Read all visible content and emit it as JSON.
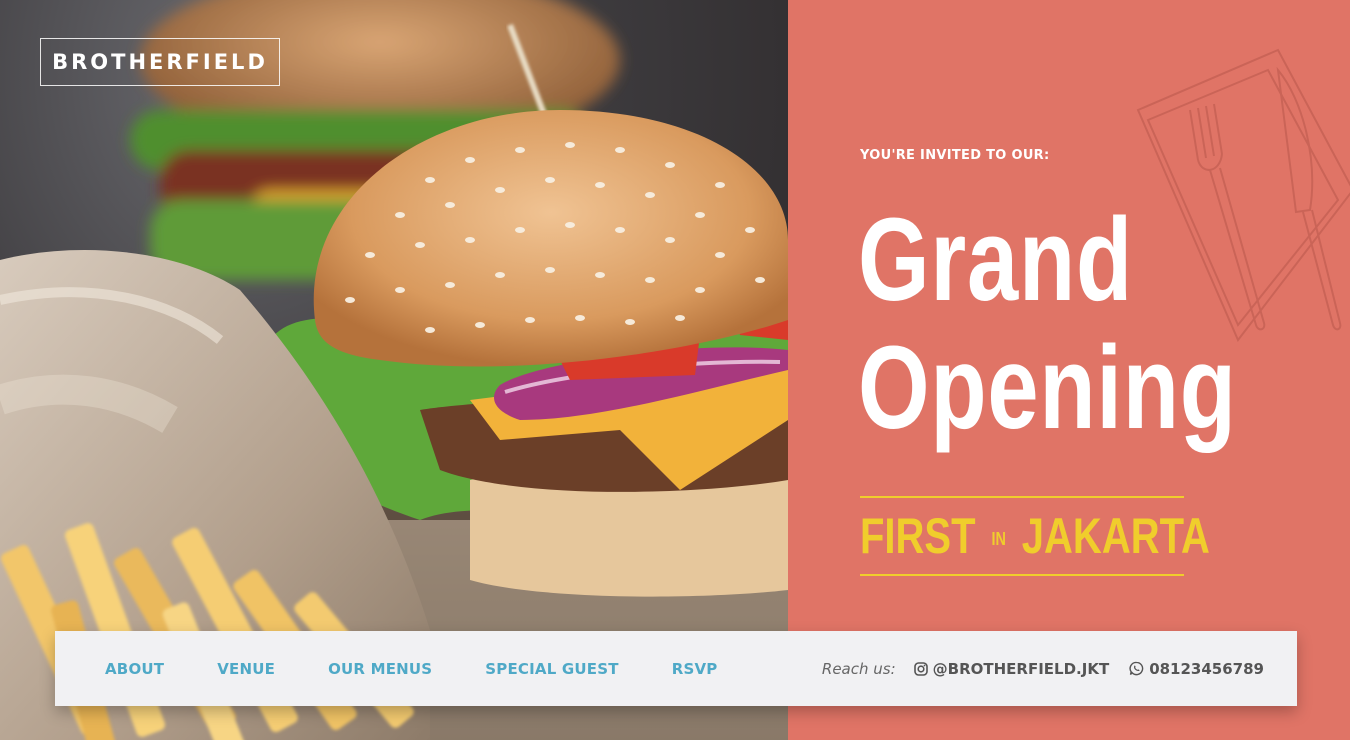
{
  "brand": {
    "name": "BROTHERFIELD"
  },
  "hero": {
    "invite": "YOU'RE INVITED TO OUR:",
    "title_line1": "Grand",
    "title_line2": "Opening",
    "sub_first": "FIRST",
    "sub_in": "IN",
    "sub_city": "JAKARTA"
  },
  "nav": {
    "items": [
      {
        "label": "ABOUT"
      },
      {
        "label": "VENUE"
      },
      {
        "label": "OUR MENUS"
      },
      {
        "label": "SPECIAL GUEST"
      },
      {
        "label": "RSVP"
      }
    ],
    "reach_label": "Reach us:",
    "instagram": "@BROTHERFIELD.JKT",
    "phone": "08123456789"
  },
  "colors": {
    "panel": "#e07466",
    "accent_yellow": "#f0cd2c",
    "nav_link": "#4fa9c7",
    "nav_bg": "#f1f1f3"
  },
  "icons": {
    "instagram": "instagram-icon",
    "whatsapp": "whatsapp-icon"
  }
}
